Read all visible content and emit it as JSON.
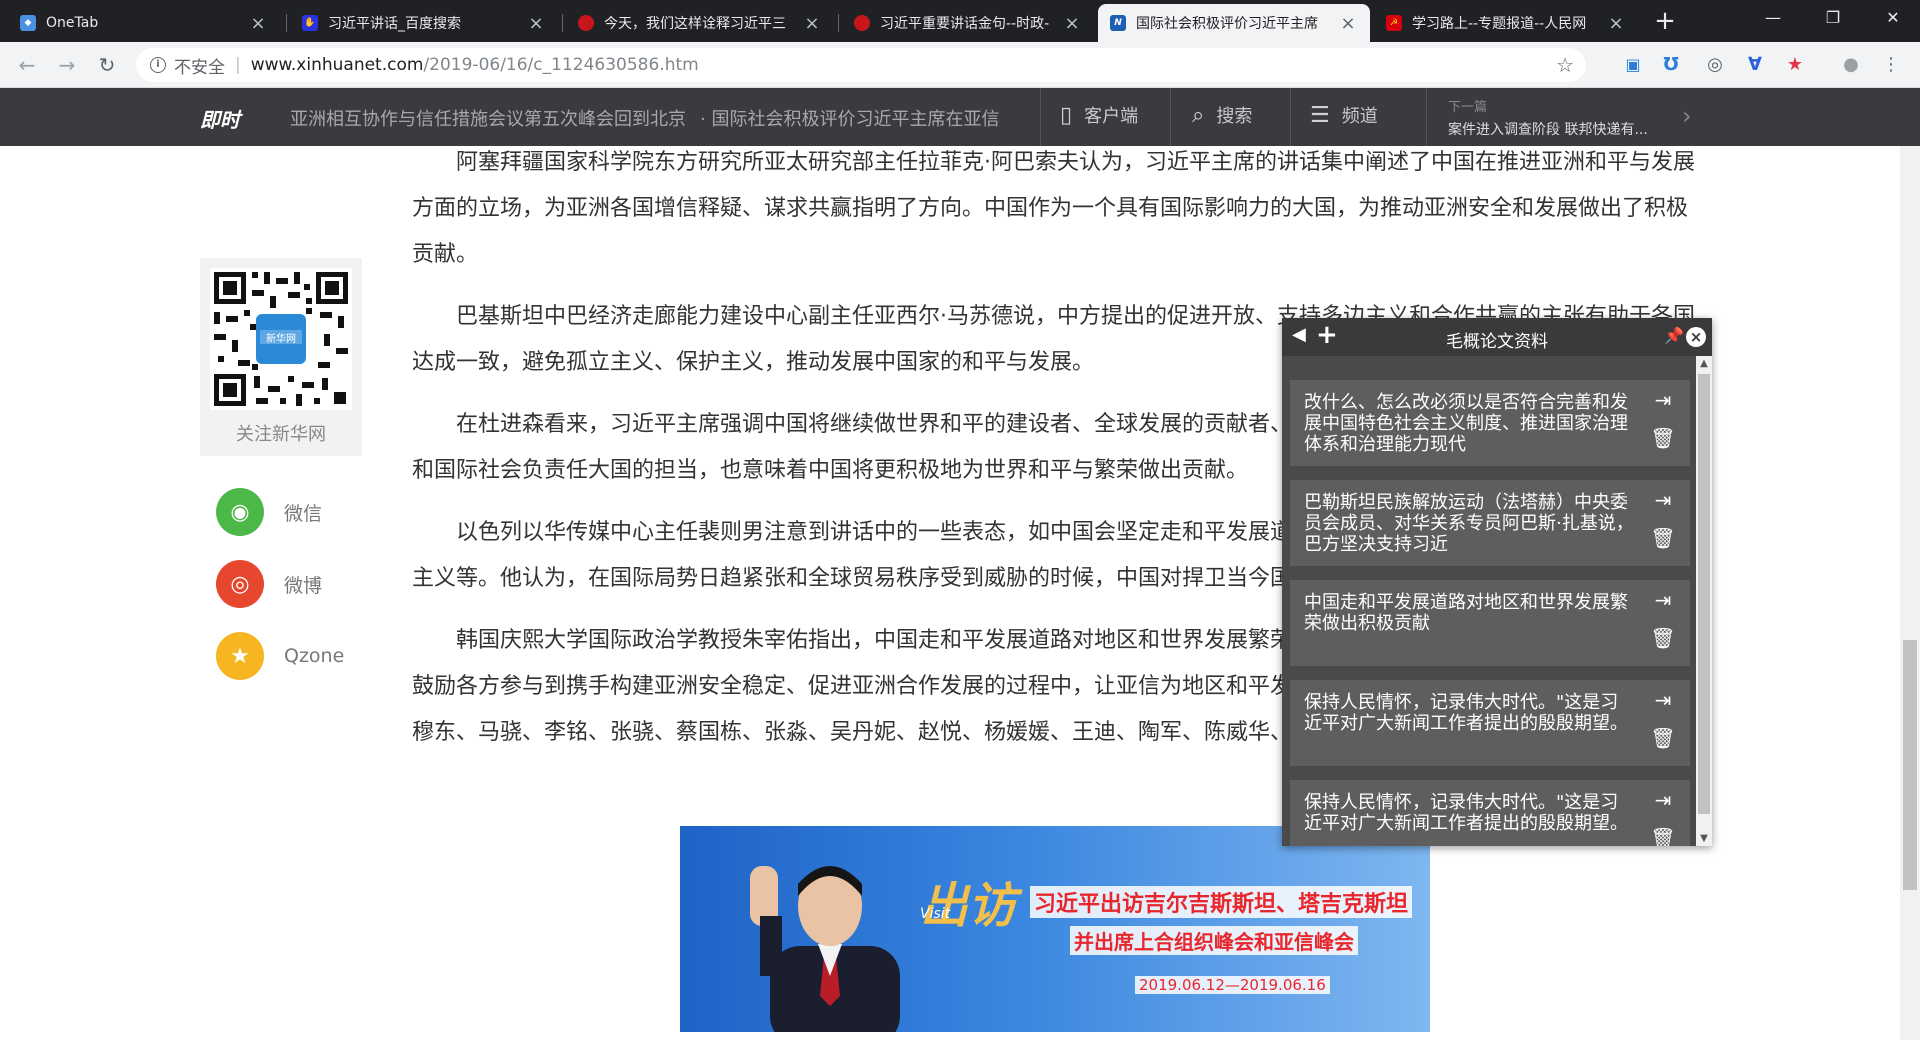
{
  "browser": {
    "tabs": [
      {
        "title": "OneTab",
        "favicon": "onetab-icon",
        "color": "#4a90e2",
        "active": false
      },
      {
        "title": "习近平讲话_百度搜索",
        "favicon": "baidu-icon",
        "color": "#2932e1",
        "active": false
      },
      {
        "title": "今天，我们这样诠释习近平三",
        "favicon": "people-icon",
        "color": "#c8161d",
        "active": false
      },
      {
        "title": "习近平重要讲话金句--时政-",
        "favicon": "people-icon",
        "color": "#c8161d",
        "active": false
      },
      {
        "title": "国际社会积极评价习近平主席",
        "favicon": "xinhua-news-icon",
        "color": "#1d5fb4",
        "active": true
      },
      {
        "title": "学习路上--专题报道--人民网",
        "favicon": "party-icon",
        "color": "#d7000f",
        "active": false
      }
    ],
    "address": {
      "insecure_label": "不安全",
      "host": "www.xinhuanet.com",
      "path": "/2019-06/16/c_1124630586.htm"
    }
  },
  "site": {
    "logo": "即时",
    "ticker1": "亚洲相互协作与信任措施会议第五次峰会回到北京",
    "ticker2": "· 国际社会积极评价习近平主席在亚信",
    "app_label": "客户端",
    "search_label": "搜索",
    "channel_label": "频道",
    "next_label": "下一篇",
    "next_title": "案件进入调查阶段 联邦快递有..."
  },
  "sidebar": {
    "qr_caption": "关注新华网",
    "qr_logo": "新华网",
    "shares": [
      {
        "label": "微信",
        "icon": "wechat-icon",
        "color": "#4cb848"
      },
      {
        "label": "微博",
        "icon": "weibo-icon",
        "color": "#e6472e"
      },
      {
        "label": "Qzone",
        "icon": "qzone-icon",
        "color": "#f5b621"
      }
    ]
  },
  "article": {
    "paragraphs": [
      "阿塞拜疆国家科学院东方研究所亚太研究部主任拉菲克·阿巴索夫认为，习近平主席的讲话集中阐述了中国在推进亚洲和平与发展方面的立场，为亚洲各国增信释疑、谋求共赢指明了方向。中国作为一个具有国际影响力的大国，为推动亚洲安全和发展做出了积极贡献。",
      "巴基斯坦中巴经济走廊能力建设中心副主任亚西尔·马苏德说，中方提出的促进开放、支持多边主义和合作共赢的主张有助于各国达成一致，避免孤立主义、保护主义，推动发展中国家的和平与发展。",
      "在杜进森看来，习近平主席强调中国将继续做世界和平的建设者、全球发展的贡献者、国际秩序的维护者，彰显了中国作为亚洲和国际社会负责任大国的担当，也意味着中国将更积极地为世界和平与繁荣做出贡献。",
      "以色列以华传媒中心主任裴则男注意到讲话中的一些表态，如中国会坚定走和平发展道路、反对单边主义和保护主义、践行多边主义等。他认为，在国际局势日趋紧张和全球贸易秩序受到威胁的时候，中国对捍卫当今国际体系表明立场意义重大。",
      "韩国庆熙大学国际政治学教授朱宰佑指出，中国走和平发展道路对地区和世界发展繁荣做出积极贡献。期待中国继续发挥作用，鼓励各方参与到携手构建亚洲安全稳定、促进亚洲合作发展的过程中，让亚信为地区和平发展做出更大贡献。（参与记者：杨元勇、穆东、马骁、李铭、张骁、蔡国栋、张淼、吴丹妮、赵悦、杨媛媛、王迪、陶军、陈威华、金正、胡晓光、朱瑞卿、唐璐、刘天）"
    ]
  },
  "banner": {
    "chufang": "出访",
    "visit": "Visit",
    "line1": "习近平出访吉尔吉斯斯坦、塔吉克斯坦",
    "line2": "并出席上合组织峰会和亚信峰会",
    "dates": "2019.06.12—2019.06.16"
  },
  "notes_popup": {
    "title": "毛概论文资料",
    "notes": [
      "改什么、怎么改必须以是否符合完善和发展中国特色社会主义制度、推进国家治理体系和治理能力现代",
      "巴勒斯坦民族解放运动（法塔赫）中央委员会成员、对华关系专员阿巴斯·扎基说，巴方坚决支持习近",
      "中国走和平发展道路对地区和世界发展繁荣做出积极贡献",
      "保持人民情怀，记录伟大时代。\"这是习近平对广大新闻工作者提出的殷殷期望。",
      "保持人民情怀，记录伟大时代。\"这是习近平对广大新闻工作者提出的殷殷期望。"
    ]
  }
}
